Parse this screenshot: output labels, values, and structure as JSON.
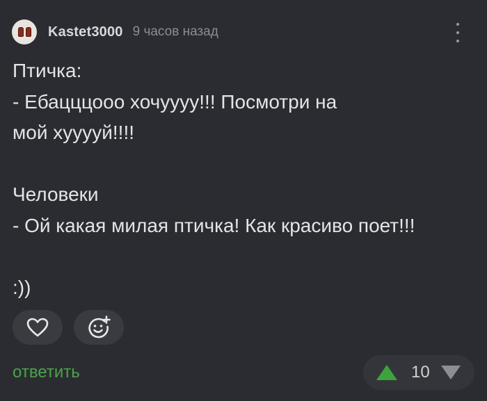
{
  "comment": {
    "author": "Kastet3000",
    "time": "9 часов назад",
    "lines": [
      "Птичка:",
      "- Ебацццооо хочуууу!!! Посмотри на",
      "мой хууууй!!!!",
      "",
      "Человеки",
      "- Ой какая милая птичка! Как красиво поет!!!",
      "",
      ":))"
    ]
  },
  "actions": {
    "reply_label": "ответить",
    "like_icon": "heart-icon",
    "add_reaction_icon": "add-emoji-icon",
    "more_icon": "more-vertical-icon"
  },
  "vote": {
    "score": "10",
    "up_icon": "arrow-up-icon",
    "down_icon": "arrow-down-icon",
    "up_color": "#3da33d",
    "down_color": "#8d8e93"
  },
  "colors": {
    "background": "#2b2c31",
    "accent": "#4aa34a"
  }
}
